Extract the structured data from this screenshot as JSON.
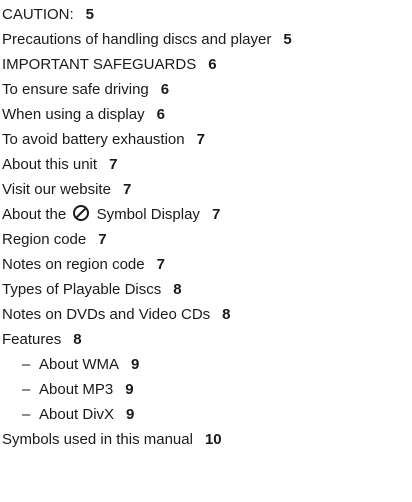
{
  "toc": {
    "entries": [
      {
        "title": "CAUTION:",
        "page": "5"
      },
      {
        "title": "Precautions of handling discs and player",
        "page": "5"
      },
      {
        "title": "IMPORTANT SAFEGUARDS",
        "page": "6"
      },
      {
        "title": "To ensure safe driving",
        "page": "6"
      },
      {
        "title": "When using a display",
        "page": "6"
      },
      {
        "title": "To avoid battery exhaustion",
        "page": "7"
      },
      {
        "title": "About this unit",
        "page": "7"
      },
      {
        "title": "Visit our website",
        "page": "7"
      },
      {
        "title_before": "About the",
        "icon": "no-symbol-icon",
        "title_after": "Symbol Display",
        "page": "7"
      },
      {
        "title": "Region code",
        "page": "7"
      },
      {
        "title": "Notes on region code",
        "page": "7"
      },
      {
        "title": "Types of Playable Discs",
        "page": "8"
      },
      {
        "title": "Notes on DVDs and Video CDs",
        "page": "8"
      },
      {
        "title": "Features",
        "page": "8"
      },
      {
        "dash": "–",
        "title": "About WMA",
        "page": "9"
      },
      {
        "dash": "–",
        "title": "About MP3",
        "page": "9"
      },
      {
        "dash": "–",
        "title": "About DivX",
        "page": "9"
      },
      {
        "title": "Symbols used in this manual",
        "page": "10"
      }
    ]
  }
}
